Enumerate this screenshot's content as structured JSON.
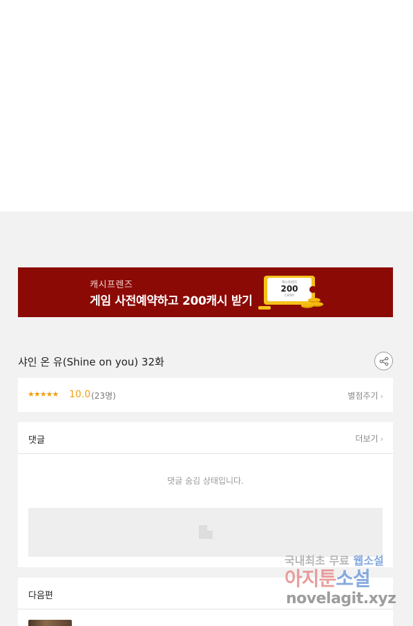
{
  "banner": {
    "small_text": "캐시프렌즈",
    "big_text": "게임 사전예약하고 200캐시 받기",
    "voucher_small": "캐시프렌즈",
    "voucher_amount": "200",
    "voucher_unit": "CASH",
    "background": "#8b0a06",
    "accent": "#f5c21b"
  },
  "episode": {
    "title": "샤인 온 유(Shine on you) 32화",
    "share_icon": "share-icon"
  },
  "rating": {
    "stars": "★★★★★",
    "score": "10.0",
    "count": "(23명)",
    "rate_link": "별점주기",
    "chevron": "›",
    "accent": "#f0a010"
  },
  "comments": {
    "header": "댓글",
    "more_link": "더보기",
    "chevron": "›",
    "hidden_message": "댓글 숨김 상태입니다."
  },
  "next": {
    "header": "다음편"
  },
  "watermark": {
    "line1_a": "국내최초 무료 ",
    "line1_b": "웹소설",
    "line2_a": "아지툰",
    "line2_b": "소설",
    "line3": "novelagit.xyz"
  }
}
